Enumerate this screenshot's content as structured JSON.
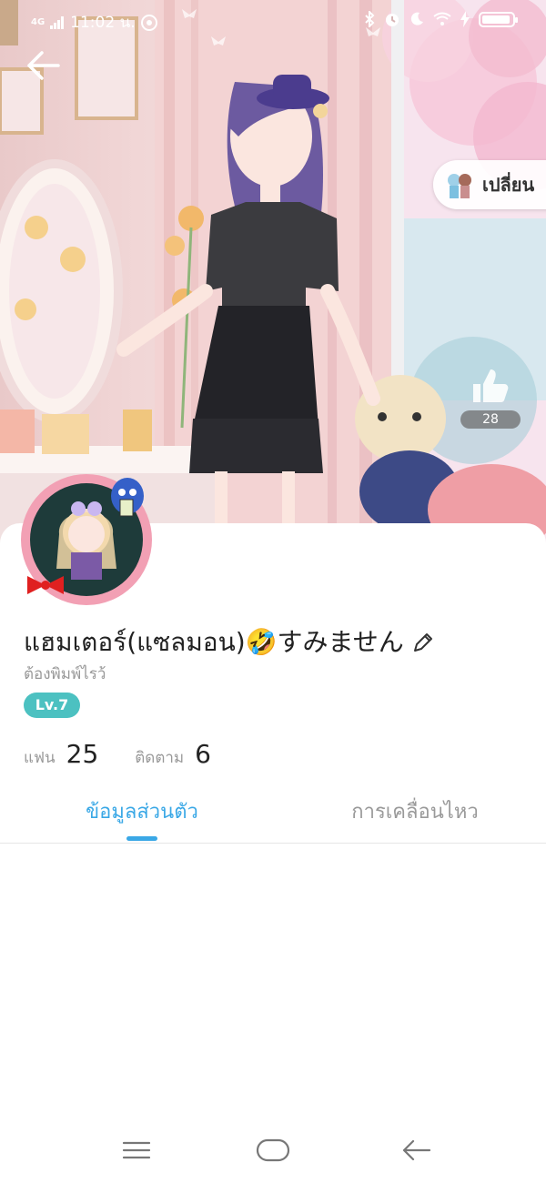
{
  "status_bar": {
    "network": "4G",
    "time": "11:02 น.",
    "battery_level": 0.95
  },
  "hero": {
    "change_button_label": "เปลี่ยน",
    "like_count": "28"
  },
  "profile": {
    "username": "แฮมเตอร์(แซลมอน)🤣すみません",
    "signature": "ต้องพิมพ์ไรว้",
    "level": "Lv.7",
    "stats": [
      {
        "label": "แฟน",
        "value": "25"
      },
      {
        "label": "ติดตาม",
        "value": "6"
      }
    ]
  },
  "tabs": [
    {
      "label": "ข้อมูลส่วนตัว",
      "active": true
    },
    {
      "label": "การเคลื่อนไหว",
      "active": false
    }
  ],
  "colors": {
    "accent": "#3aa8e6",
    "level_badge": "#4cc1c1"
  },
  "icons": {
    "back": "arrow-left-icon",
    "edit": "pencil-icon",
    "like": "thumbs-up-icon",
    "nav_menu": "menu-icon",
    "nav_home": "home-icon",
    "nav_back": "nav-back-icon"
  }
}
